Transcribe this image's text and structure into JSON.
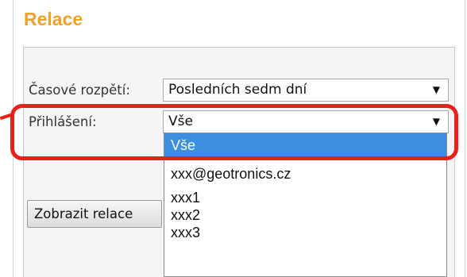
{
  "panel": {
    "title": "Relace"
  },
  "form": {
    "time_range_label": "Časové rozpětí:",
    "time_range_value": "Posledních sedm dní",
    "login_label": "Přihlášení:",
    "login_value": "Vše"
  },
  "dropdown": {
    "options": [
      "Vše",
      "xxx@geotronics.cz",
      "xxx1",
      "xxx2",
      "xxx3"
    ],
    "selected_index": 0
  },
  "button": {
    "view_sessions_label": "Zobrazit relace"
  },
  "colors": {
    "title": "#f0a226",
    "highlight": "#e8201c",
    "selection": "#3d8ee0"
  }
}
